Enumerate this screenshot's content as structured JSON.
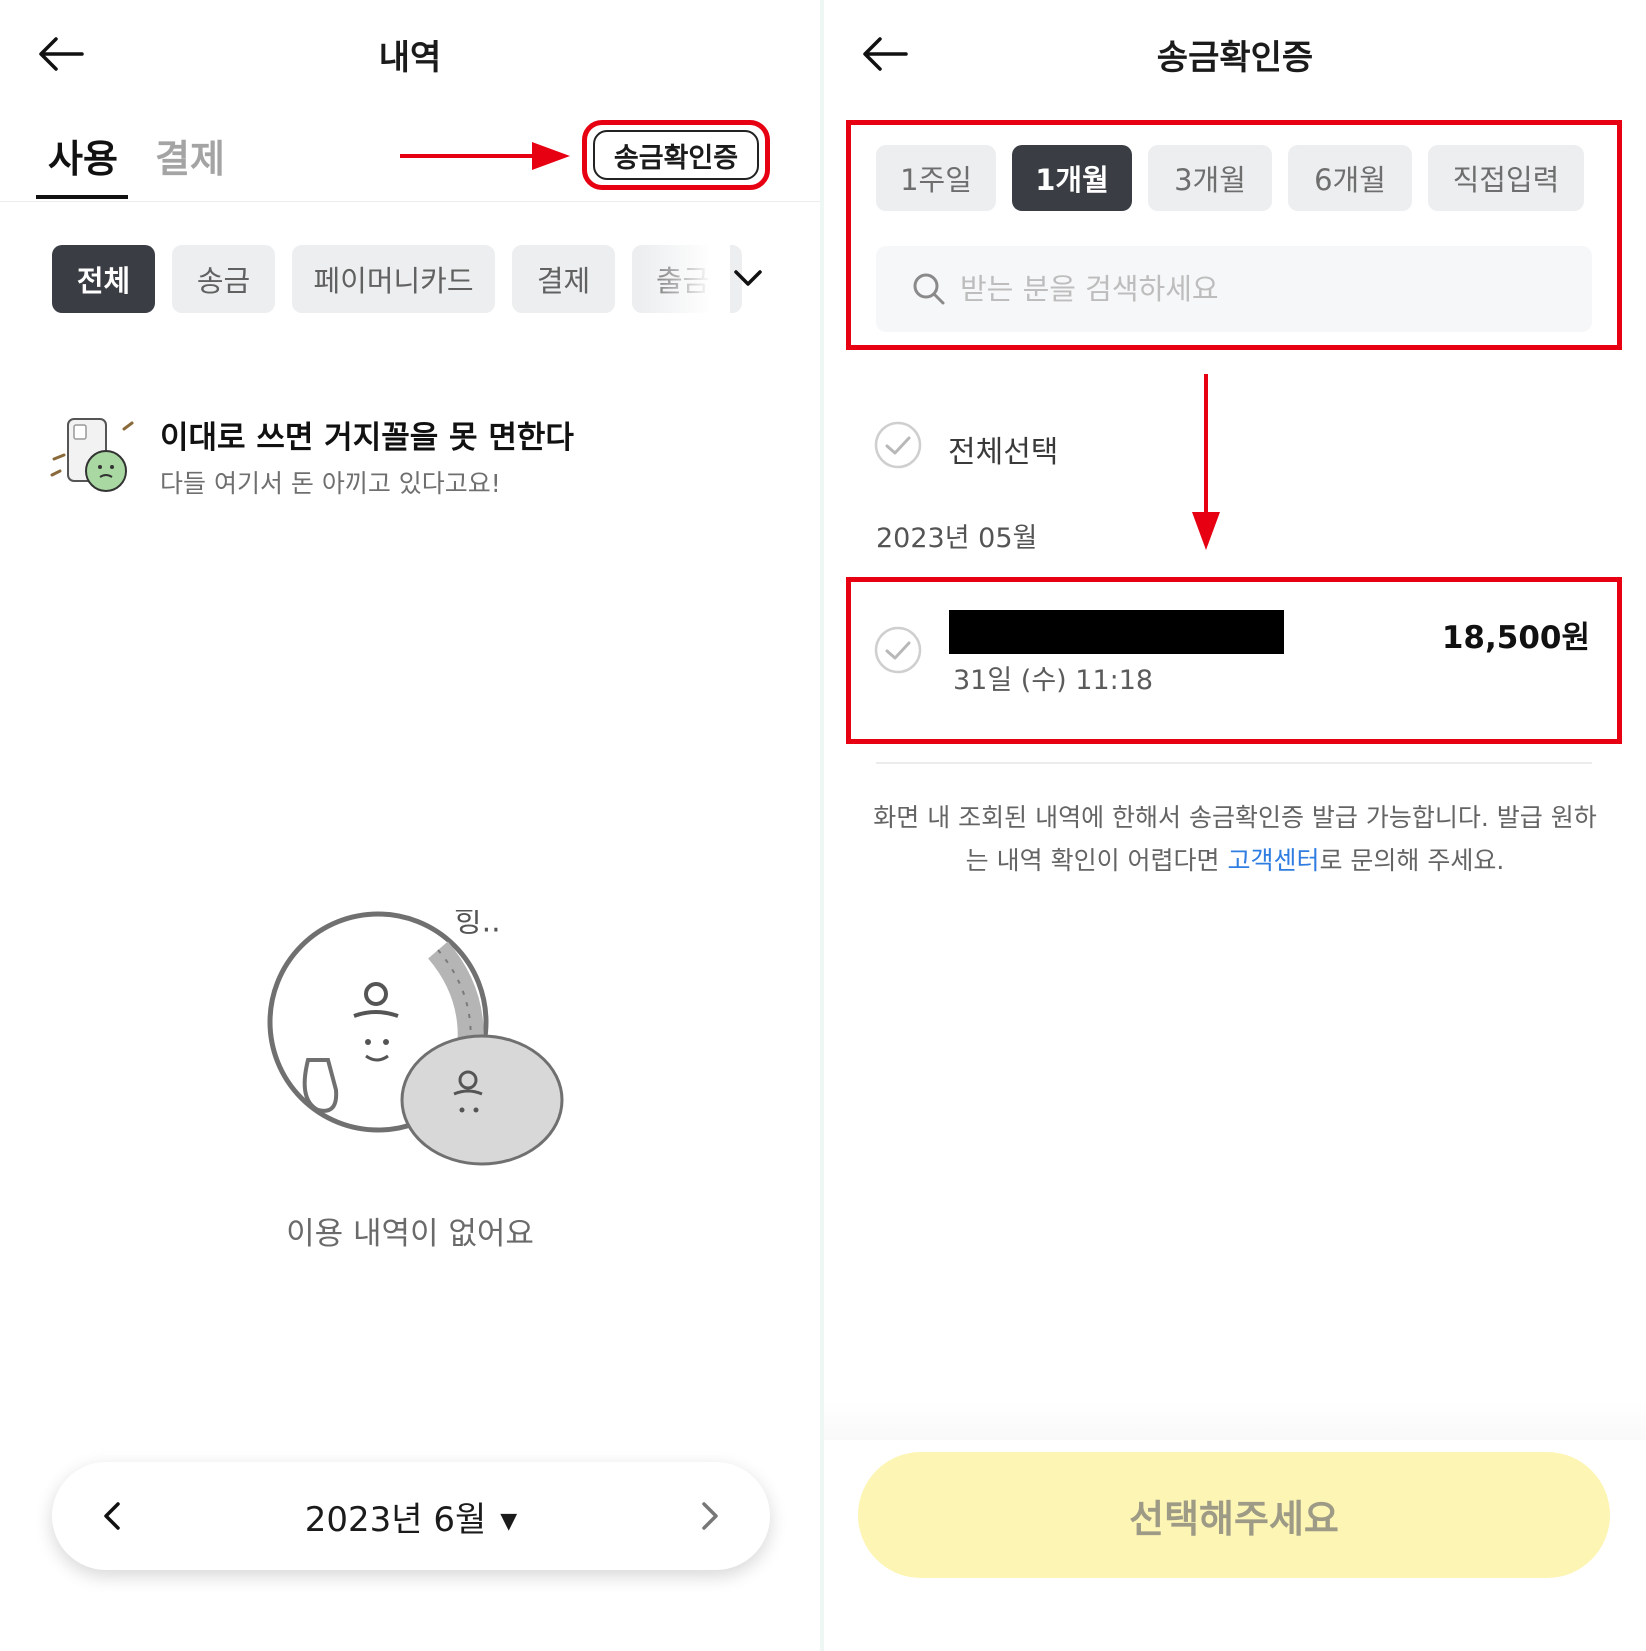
{
  "left": {
    "header": {
      "title": "내역"
    },
    "tabs": [
      {
        "label": "사용"
      },
      {
        "label": "결제"
      }
    ],
    "cert_button_label": "송금확인증",
    "filters": [
      {
        "label": "전체"
      },
      {
        "label": "송금"
      },
      {
        "label": "페이머니카드"
      },
      {
        "label": "결제"
      },
      {
        "label": "출금"
      }
    ],
    "promo": {
      "title": "이대로 쓰면 거지꼴을 못 면한다",
      "subtitle": "다들 여기서 돈 아끼고 있다고요!"
    },
    "empty": {
      "illustration_text": "힝..",
      "text": "이용 내역이 없어요"
    },
    "month_selector": {
      "label": "2023년 6월"
    }
  },
  "right": {
    "header": {
      "title": "송금확인증"
    },
    "periods": [
      {
        "label": "1주일"
      },
      {
        "label": "1개월"
      },
      {
        "label": "3개월"
      },
      {
        "label": "6개월"
      },
      {
        "label": "직접입력"
      }
    ],
    "search": {
      "placeholder": "받는 분을 검색하세요"
    },
    "select_all_label": "전체선택",
    "month_group": "2023년 05월",
    "transaction": {
      "amount": "18,500원",
      "date": "31일 (수) 11:18"
    },
    "notice": {
      "before_link": "화면 내 조회된 내역에 한해서 송금확인증 발급 가능합니다. 발급 원하는 내역 확인이 어렵다면 ",
      "link": "고객센터",
      "after_link": "로 문의해 주세요."
    },
    "confirm_button_label": "선택해주세요"
  },
  "colors": {
    "annotation_red": "#e60012",
    "active_chip": "#3a3e44",
    "confirm_disabled": "#fdf5b4",
    "link": "#2f7de1"
  },
  "icons": [
    "back-arrow-icon",
    "chevron-down-icon",
    "chevron-left-icon",
    "chevron-right-icon",
    "caret-down-icon",
    "search-icon",
    "check-circle-icon"
  ]
}
